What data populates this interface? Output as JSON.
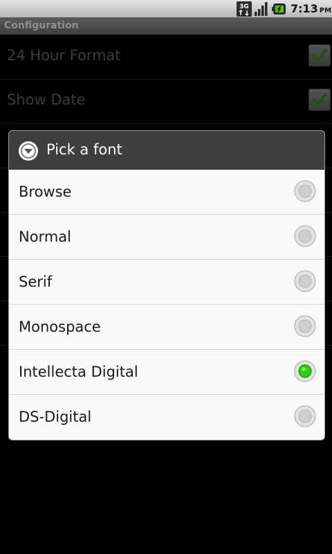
{
  "status_bar": {
    "network_type": "3G",
    "time": "7:13",
    "ampm": "PM",
    "icons": [
      "3g-data-icon",
      "signal-strength-icon",
      "battery-charging-icon"
    ]
  },
  "app": {
    "title": "Configuration"
  },
  "preferences": [
    {
      "label": "24 Hour Format",
      "checked": true
    },
    {
      "label": "Show Date",
      "checked": true
    }
  ],
  "dialog": {
    "title": "Pick a font",
    "icon": "dropdown-arrow-icon",
    "options": [
      {
        "label": "Browse",
        "selected": false
      },
      {
        "label": "Normal",
        "selected": false
      },
      {
        "label": "Serif",
        "selected": false
      },
      {
        "label": "Monospace",
        "selected": false
      },
      {
        "label": "Intellecta Digital",
        "selected": true
      },
      {
        "label": "DS-Digital",
        "selected": false
      }
    ]
  },
  "colors": {
    "accent_check": "#3c9a1f",
    "radio_selected": "#2ad10e",
    "dialog_header": "#3e3e3e",
    "dialog_body": "#f9f9f9"
  }
}
